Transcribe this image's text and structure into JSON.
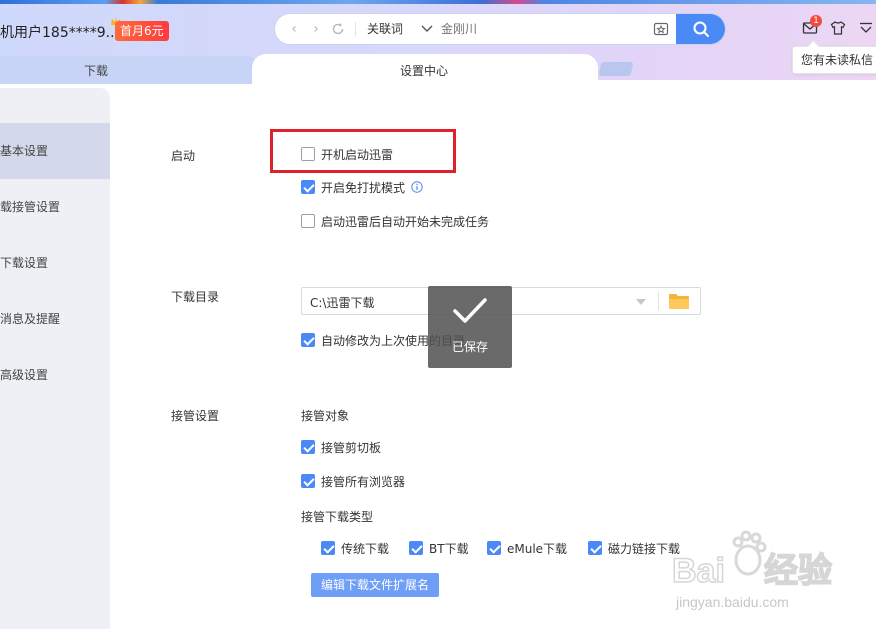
{
  "header": {
    "user_name": "机用户185****9...",
    "vip_badge": "首月6元",
    "search": {
      "keyword_type": "关联词",
      "placeholder": "金刚川"
    },
    "message_count": "1",
    "tooltip": "您有未读私信"
  },
  "tabs": {
    "download": "下载",
    "settings": "设置中心"
  },
  "sidebar": {
    "items": [
      {
        "label": "基本设置"
      },
      {
        "label": "载接管设置"
      },
      {
        "label": "下载设置"
      },
      {
        "label": "消息及提醒"
      },
      {
        "label": "高级设置"
      }
    ]
  },
  "startup": {
    "label": "启动",
    "options": [
      {
        "label": "开机启动迅雷",
        "checked": false
      },
      {
        "label": "开启免打扰模式",
        "checked": true
      },
      {
        "label": "启动迅雷后自动开始未完成任务",
        "checked": false
      }
    ]
  },
  "download_dir": {
    "label": "下载目录",
    "path": "C:\\迅雷下载",
    "auto_modify_label": "自动修改为上次使用的目录",
    "auto_modify_checked": true
  },
  "toast": {
    "text": "已保存"
  },
  "takeover": {
    "label": "接管设置",
    "target_label": "接管对象",
    "targets": [
      {
        "label": "接管剪切板",
        "checked": true
      },
      {
        "label": "接管所有浏览器",
        "checked": true
      }
    ],
    "types_label": "接管下载类型",
    "types": [
      {
        "label": "传统下载",
        "checked": true
      },
      {
        "label": "BT下载",
        "checked": true
      },
      {
        "label": "eMule下载",
        "checked": true
      },
      {
        "label": "磁力链接下载",
        "checked": true
      }
    ],
    "ext_button": "编辑下载文件扩展名"
  },
  "watermark": {
    "text": "jingyan.baidu.com"
  },
  "colors": {
    "accent": "#4b8af6",
    "highlight": "#e0202a"
  }
}
